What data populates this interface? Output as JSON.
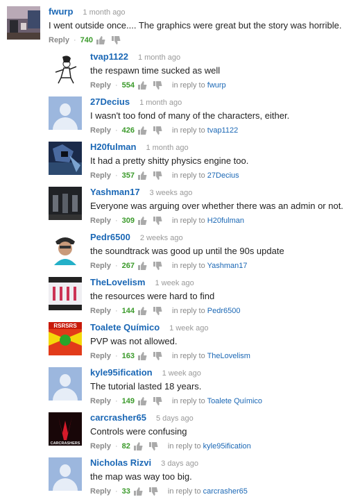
{
  "labels": {
    "reply": "Reply",
    "in_reply_to": "in reply to"
  },
  "colors": {
    "author": "#1a67b5",
    "likes": "#3a9a2a",
    "default_avatar": "#9cb7de"
  },
  "top_comment": {
    "author": "fwurp",
    "time": "1 month ago",
    "text": "I went outside once.... The graphics were great but the story was horrible.",
    "likes": "740",
    "avatar": "photo-avatar"
  },
  "replies": [
    {
      "author": "tvap1122",
      "time": "1 month ago",
      "text": "the respawn time sucked as well",
      "likes": "554",
      "in_reply_to": "fwurp",
      "avatar": "sketch-figure-avatar"
    },
    {
      "author": "27Decius",
      "time": "1 month ago",
      "text": "I wasn't too fond of many of the characters, either.",
      "likes": "426",
      "in_reply_to": "tvap1122",
      "avatar": "default-avatar"
    },
    {
      "author": "H20fulman",
      "time": "1 month ago",
      "text": "It had a pretty shitty physics engine too.",
      "likes": "357",
      "in_reply_to": "27Decius",
      "avatar": "game-scene-avatar"
    },
    {
      "author": "Yashman17",
      "time": "3 weeks ago",
      "text": "Everyone was arguing over whether there was an admin or not.",
      "likes": "309",
      "in_reply_to": "H20fulman",
      "avatar": "dark-figures-avatar"
    },
    {
      "author": "Pedr6500",
      "time": "2 weeks ago",
      "text": "the soundtrack was good up until the 90s update",
      "likes": "267",
      "in_reply_to": "Yashman17",
      "avatar": "person-avatar"
    },
    {
      "author": "TheLovelism",
      "time": "1 week ago",
      "text": "the resources were hard to find",
      "likes": "144",
      "in_reply_to": "Pedr6500",
      "avatar": "dancers-avatar"
    },
    {
      "author": "Toalete Químico",
      "time": "1 week ago",
      "text": "PVP was not allowed.",
      "likes": "163",
      "in_reply_to": "TheLovelism",
      "avatar": "rsrsrs-avatar"
    },
    {
      "author": "kyle95ification",
      "time": "1 week ago",
      "text": "The tutorial lasted 18 years.",
      "likes": "149",
      "in_reply_to": "Toalete Químico",
      "avatar": "default-avatar"
    },
    {
      "author": "carcrasher65",
      "time": "5 days ago",
      "text": "Controls were confusing",
      "likes": "82",
      "in_reply_to": "kyle95ification",
      "avatar": "carcrashers-avatar"
    },
    {
      "author": "Nicholas Rizvi",
      "time": "3 days ago",
      "text": "the map was way too big.",
      "likes": "33",
      "in_reply_to": "carcrasher65",
      "avatar": "default-avatar"
    }
  ],
  "avatar_logo_text": {
    "rsrsrs": "RSRSRS",
    "carcrashers": "CARCRASHERS"
  }
}
